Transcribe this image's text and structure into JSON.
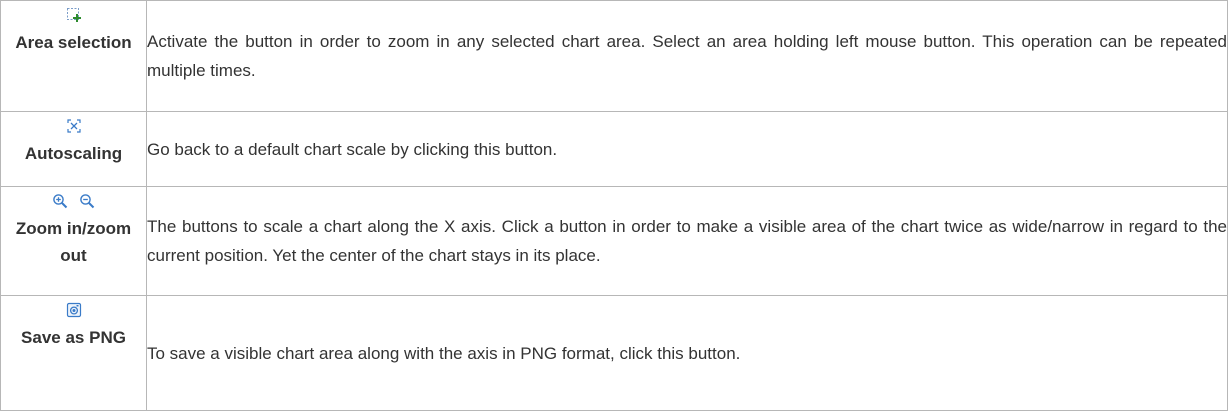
{
  "rows": [
    {
      "label": "Area selection",
      "icons": [
        "area-selection-icon"
      ],
      "description": "Activate the button in order to zoom in any selected chart area. Select an area holding left mouse button. This operation can be repeated multiple times."
    },
    {
      "label": "Autoscaling",
      "icons": [
        "autoscaling-icon"
      ],
      "description": "Go back to a default chart scale by clicking this button."
    },
    {
      "label": "Zoom in/zoom out",
      "icons": [
        "zoom-in-icon",
        "zoom-out-icon"
      ],
      "description": "The buttons to scale a chart along the X axis. Click a button in order to make a visible area of the chart twice as wide/narrow in regard to the current position. Yet the center of the chart stays in its place."
    },
    {
      "label": "Save as PNG",
      "icons": [
        "save-png-icon"
      ],
      "description": "To save a visible chart area along with the axis in PNG format, click this button."
    }
  ],
  "colors": {
    "icon_blue": "#3a7bc8",
    "border": "#b7b7b7",
    "text": "#333333"
  }
}
